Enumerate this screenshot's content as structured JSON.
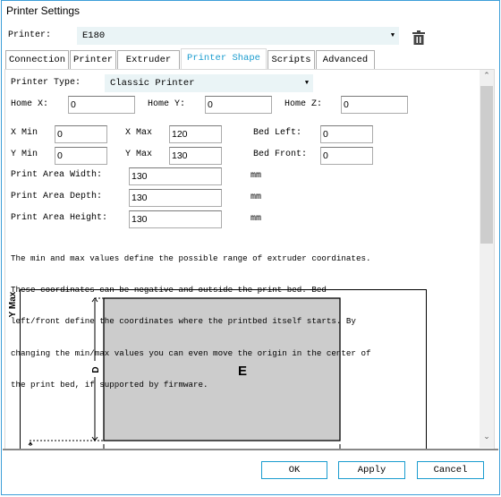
{
  "window": {
    "title": "Printer Settings"
  },
  "printer": {
    "label": "Printer:",
    "value": "E180"
  },
  "tabs": [
    {
      "label": "Connection"
    },
    {
      "label": "Printer"
    },
    {
      "label": "Extruder"
    },
    {
      "label": "Printer Shape",
      "active": true
    },
    {
      "label": "Scripts"
    },
    {
      "label": "Advanced"
    }
  ],
  "shape": {
    "printer_type": {
      "label": "Printer Type:",
      "value": "Classic Printer"
    },
    "home_x": {
      "label": "Home X:",
      "value": "0"
    },
    "home_y": {
      "label": "Home Y:",
      "value": "0"
    },
    "home_z": {
      "label": "Home Z:",
      "value": "0"
    },
    "x_min": {
      "label": "X Min",
      "value": "0"
    },
    "x_max": {
      "label": "X Max",
      "value": "120"
    },
    "bed_left": {
      "label": "Bed Left:",
      "value": "0"
    },
    "y_min": {
      "label": "Y Min",
      "value": "0"
    },
    "y_max": {
      "label": "Y Max",
      "value": "130"
    },
    "bed_front": {
      "label": "Bed Front:",
      "value": "0"
    },
    "width": {
      "label": "Print Area Width:",
      "value": "130",
      "unit": "mm"
    },
    "depth": {
      "label": "Print Area Depth:",
      "value": "130",
      "unit": "mm"
    },
    "height": {
      "label": "Print Area Height:",
      "value": "130",
      "unit": "mm"
    },
    "description": [
      "The min and max values define the possible range of extruder coordinates.",
      "These coordinates can be negative and outside the print bed. Bed",
      "left/front define the coordinates where the printbed itself starts. By",
      "changing the min/max values you can even move the origin in the center of",
      "the print bed, if supported by firmware."
    ],
    "diagram": {
      "y_max_label": "Y Max",
      "depth_label": "D",
      "bed_label": "E"
    }
  },
  "buttons": {
    "ok": "OK",
    "apply": "Apply",
    "cancel": "Cancel"
  },
  "colors": {
    "accent": "#1a9ccf",
    "combo_bg": "#eaf4f6",
    "bed_fill": "#cccccc"
  }
}
